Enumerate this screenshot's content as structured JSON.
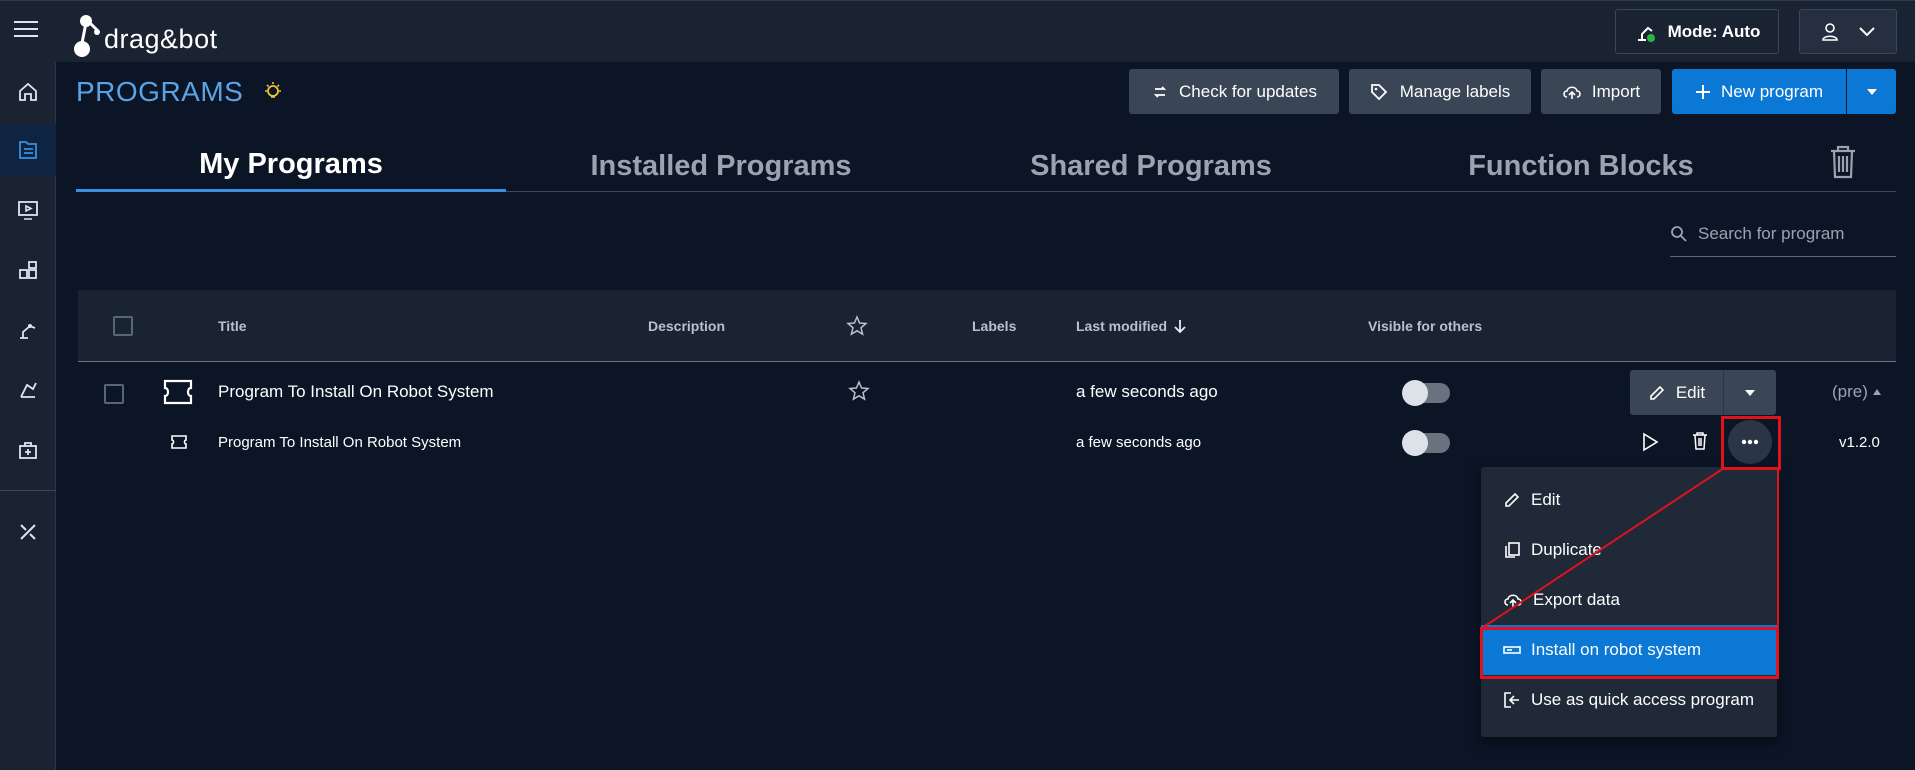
{
  "app": {
    "logo_text": "drag&bot"
  },
  "topbar": {
    "mode_label": "Mode: Auto"
  },
  "page": {
    "title": "PROGRAMS"
  },
  "header_buttons": {
    "check_updates": "Check for updates",
    "manage_labels": "Manage labels",
    "import": "Import",
    "new_program": "New program"
  },
  "tabs": [
    {
      "label": "My Programs",
      "active": true
    },
    {
      "label": "Installed Programs"
    },
    {
      "label": "Shared Programs"
    },
    {
      "label": "Function Blocks"
    }
  ],
  "search": {
    "placeholder": "Search for program"
  },
  "table": {
    "headers": {
      "title": "Title",
      "description": "Description",
      "labels": "Labels",
      "last_modified": "Last modified",
      "visible": "Visible for others"
    },
    "rows": [
      {
        "title": "Program To Install On Robot System",
        "modified": "a few seconds ago",
        "version": "(pre)",
        "edit_label": "Edit"
      },
      {
        "title": "Program To Install On Robot System",
        "modified": "a few seconds ago",
        "version": "v1.2.0"
      }
    ]
  },
  "context_menu": {
    "items": [
      {
        "label": "Edit",
        "icon": "pencil-icon"
      },
      {
        "label": "Duplicate",
        "icon": "duplicate-icon"
      },
      {
        "label": "Export data",
        "icon": "upload-cloud-icon"
      },
      {
        "label": "Install on robot system",
        "icon": "device-icon",
        "selected": true
      },
      {
        "label": "Use as quick access program",
        "icon": "exit-icon"
      }
    ]
  },
  "colors": {
    "accent": "#0a78d4",
    "highlight": "#e0121b",
    "title": "#5aa3e6"
  }
}
